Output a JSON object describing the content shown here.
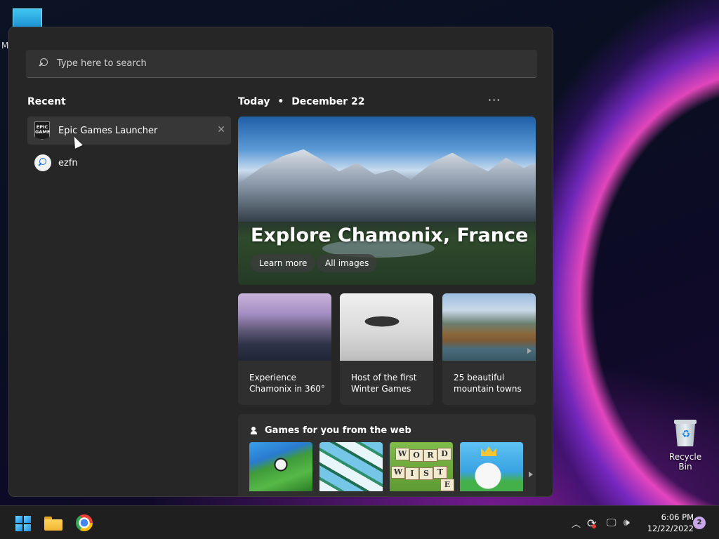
{
  "desktop": {
    "partial_label": "M",
    "recycle_bin_label": "Recycle Bin"
  },
  "search": {
    "placeholder": "Type here to search"
  },
  "recent": {
    "heading": "Recent",
    "items": [
      {
        "label": "Epic Games Launcher",
        "icon": "epic-games-icon",
        "icon_text": "EPIC GAMES"
      },
      {
        "label": "ezfn",
        "icon": "search-icon"
      }
    ]
  },
  "today": {
    "label": "Today",
    "separator": "•",
    "date": "December 22",
    "more": "···"
  },
  "hero": {
    "title": "Explore Chamonix, France",
    "buttons": [
      "Learn more",
      "All images"
    ]
  },
  "cards": [
    {
      "line1": "Experience",
      "line2": "Chamonix in 360°"
    },
    {
      "line1": "Host of the first",
      "line2": "Winter Games"
    },
    {
      "line1": "25 beautiful",
      "line2": "mountain towns"
    }
  ],
  "games": {
    "heading": "Games for you from the web",
    "word_tiles": [
      "W",
      "O",
      "R",
      "D",
      "W",
      "I",
      "S",
      "T",
      "E"
    ]
  },
  "taskbar": {
    "time": "6:06 PM",
    "date": "12/22/2022",
    "notification_count": "2"
  },
  "colors": {
    "menu_bg": "#262626",
    "card_bg": "#2f2f2f",
    "taskbar_bg": "#1f1f1f",
    "accent": "#1a8ce6"
  }
}
